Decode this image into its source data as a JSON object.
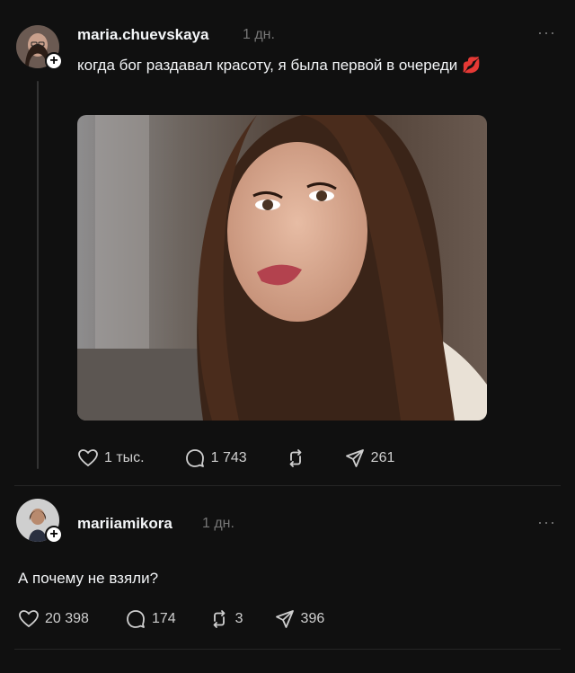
{
  "post": {
    "username": "maria.chuevskaya",
    "time": "1 дн.",
    "more": "···",
    "text": "когда бог раздавал красоту, я была первой в очереди 💋",
    "likes": "1 тыс.",
    "comments": "1 743",
    "reposts": "",
    "shares": "261"
  },
  "reply": {
    "username": "mariiamikora",
    "time": "1 дн.",
    "more": "···",
    "text": "А почему не взяли?",
    "likes": "20 398",
    "comments": "174",
    "reposts": "3",
    "shares": "396"
  },
  "icons": {
    "like": "heart-icon",
    "comment": "comment-bubble-icon",
    "repost": "repost-icon",
    "share": "send-icon",
    "follow": "plus-icon"
  },
  "colors": {
    "background": "#101010",
    "text": "#f3f5f7",
    "muted": "#777777"
  }
}
